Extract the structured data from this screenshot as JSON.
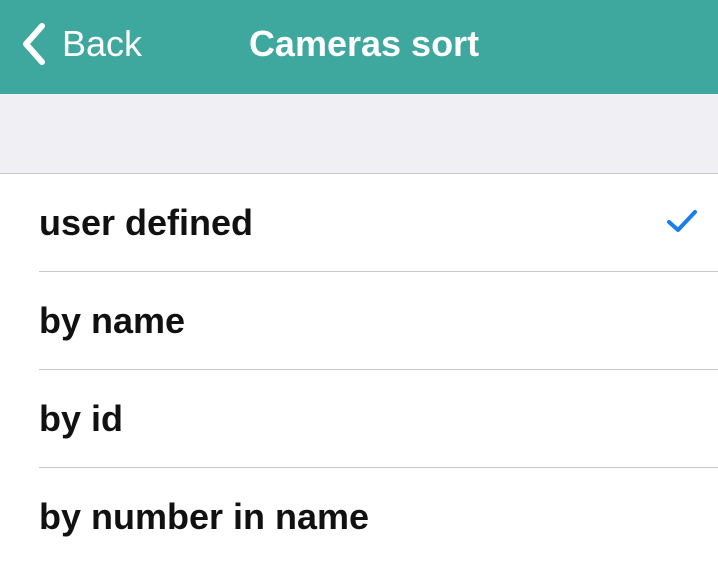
{
  "navbar": {
    "back_label": "Back",
    "title": "Cameras sort",
    "background_color": "#3ea79e"
  },
  "sort_options": [
    {
      "label": "user defined",
      "selected": true
    },
    {
      "label": "by name",
      "selected": false
    },
    {
      "label": "by id",
      "selected": false
    },
    {
      "label": "by number in name",
      "selected": false
    }
  ],
  "accent_color": "#1a7cf2"
}
